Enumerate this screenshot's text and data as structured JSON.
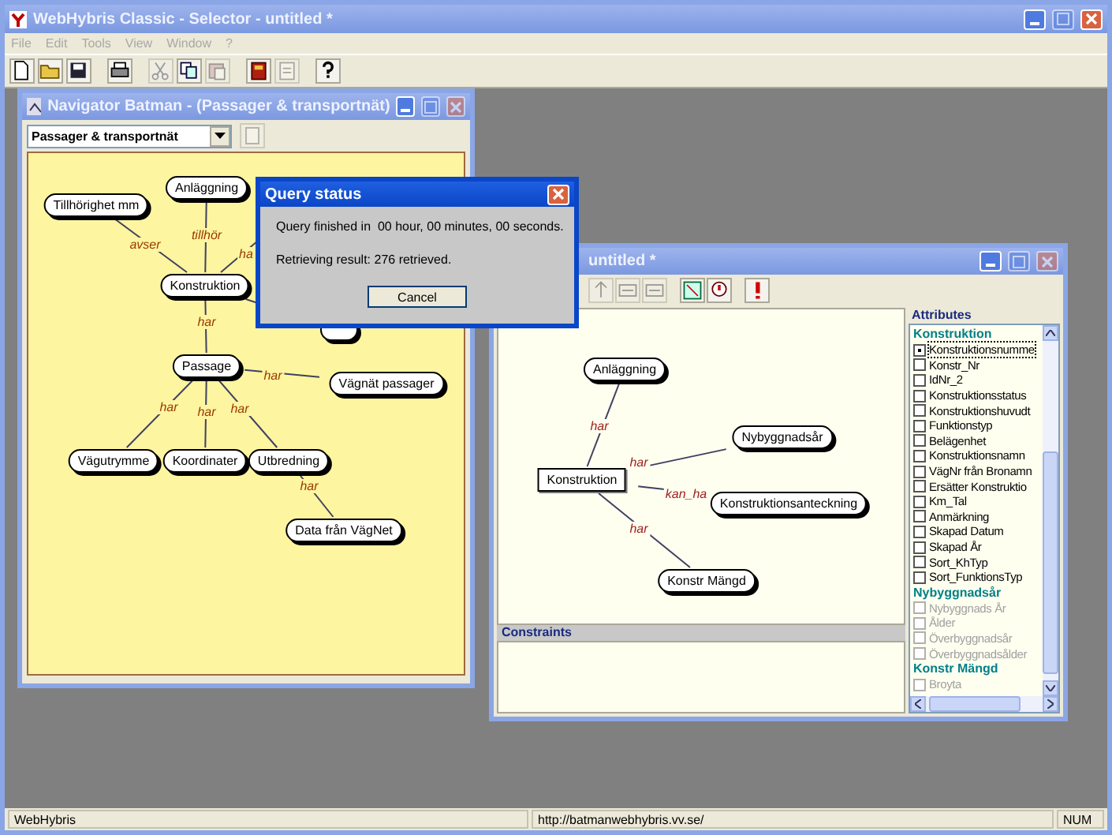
{
  "app": {
    "title": "WebHybris Classic - Selector - untitled *",
    "active": false,
    "menu": [
      {
        "label": "File",
        "disabled": true
      },
      {
        "label": "Edit",
        "disabled": true
      },
      {
        "label": "Tools",
        "disabled": true
      },
      {
        "label": "View",
        "disabled": true
      },
      {
        "label": "Window",
        "disabled": true
      },
      {
        "label": "?",
        "disabled": true
      }
    ],
    "toolbar": [
      {
        "kind": "new",
        "disabled": false
      },
      {
        "kind": "open",
        "disabled": false
      },
      {
        "kind": "save",
        "disabled": false
      },
      {
        "kind": "print",
        "disabled": false
      },
      {
        "kind": "cut",
        "disabled": true
      },
      {
        "kind": "copy",
        "disabled": false
      },
      {
        "kind": "paste",
        "disabled": true
      },
      {
        "kind": "book",
        "disabled": false
      },
      {
        "kind": "page",
        "disabled": true
      },
      {
        "kind": "help",
        "disabled": false
      }
    ]
  },
  "navigator": {
    "title": "Navigator Batman - (Passager & transportnät)",
    "active": false,
    "combo": {
      "value": "Passager & transportnät"
    },
    "nodes": [
      {
        "label": "Anläggning"
      },
      {
        "label": "Tillhörighet mm"
      },
      {
        "label": "Konstruktion"
      },
      {
        "label": "Passage"
      },
      {
        "label": "Vägnät passager"
      },
      {
        "label": "Vägutrymme"
      },
      {
        "label": "Koordinater"
      },
      {
        "label": "Utbredning"
      },
      {
        "label": "Data från VägNet"
      }
    ],
    "edge_labels": [
      {
        "text": "tillhör"
      },
      {
        "text": "avser"
      },
      {
        "text": "ha"
      },
      {
        "text": "har"
      },
      {
        "text": "har"
      },
      {
        "text": "har"
      },
      {
        "text": "har"
      },
      {
        "text": "har"
      },
      {
        "text": "har"
      }
    ]
  },
  "selector": {
    "title": "untitled *",
    "active": false,
    "toolbar": [
      {
        "kind": "up",
        "disabled": true
      },
      {
        "kind": "not",
        "disabled": true
      },
      {
        "kind": "not",
        "disabled": true
      },
      {
        "kind": "zoom",
        "disabled": false
      },
      {
        "kind": "query",
        "disabled": false
      },
      {
        "kind": "alert",
        "disabled": false
      }
    ],
    "nodes": [
      {
        "label": "Anläggning",
        "kind": "pill"
      },
      {
        "label": "Nybyggnadsår",
        "kind": "pill"
      },
      {
        "label": "Konstruktion",
        "kind": "box"
      },
      {
        "label": "Konstruktionsanteckning",
        "kind": "pill"
      },
      {
        "label": "Konstr Mängd",
        "kind": "pill"
      }
    ],
    "edge_labels": [
      {
        "text": "har"
      },
      {
        "text": "har"
      },
      {
        "text": "kan_ha"
      },
      {
        "text": "har"
      }
    ],
    "attributes": {
      "title": "Attributes",
      "groups": [
        {
          "title": "Konstruktion",
          "items": [
            {
              "label": "Konstruktionsnumme",
              "checked": true,
              "disabled": false
            },
            {
              "label": "Konstr_Nr",
              "checked": false,
              "disabled": false
            },
            {
              "label": "IdNr_2",
              "checked": false,
              "disabled": false
            },
            {
              "label": "Konstruktionsstatus",
              "checked": false,
              "disabled": false
            },
            {
              "label": "Konstruktionshuvudt",
              "checked": false,
              "disabled": false
            },
            {
              "label": "Funktionstyp",
              "checked": false,
              "disabled": false
            },
            {
              "label": "Belägenhet",
              "checked": false,
              "disabled": false
            },
            {
              "label": "Konstruktionsnamn",
              "checked": false,
              "disabled": false
            },
            {
              "label": "VägNr från Bronamn",
              "checked": false,
              "disabled": false
            },
            {
              "label": "Ersätter Konstruktio",
              "checked": false,
              "disabled": false
            },
            {
              "label": "Km_Tal",
              "checked": false,
              "disabled": false
            },
            {
              "label": "Anmärkning",
              "checked": false,
              "disabled": false
            },
            {
              "label": "Skapad Datum",
              "checked": false,
              "disabled": false
            },
            {
              "label": "Skapad År",
              "checked": false,
              "disabled": false
            },
            {
              "label": "Sort_KhTyp",
              "checked": false,
              "disabled": false
            },
            {
              "label": "Sort_FunktionsTyp",
              "checked": false,
              "disabled": false
            }
          ]
        },
        {
          "title": "Nybyggnadsår",
          "items": [
            {
              "label": "Nybyggnads År",
              "checked": false,
              "disabled": true
            },
            {
              "label": "Ålder",
              "checked": false,
              "disabled": true
            },
            {
              "label": "Överbyggnadsår",
              "checked": false,
              "disabled": true
            },
            {
              "label": "Överbyggnadsålder",
              "checked": false,
              "disabled": true
            }
          ]
        },
        {
          "title": "Konstr Mängd",
          "items": [
            {
              "label": "Broyta",
              "checked": false,
              "disabled": true
            }
          ]
        }
      ]
    },
    "constraints": {
      "title": "Constraints"
    }
  },
  "dialog": {
    "title": "Query status",
    "active": true,
    "lines": [
      "Query finished in  00 hour, 00 minutes, 00 seconds.",
      "Retrieving result: 276 retrieved."
    ],
    "button": "Cancel"
  },
  "status_bar": {
    "left": "WebHybris",
    "url": "http://batmanwebhybris.vv.se/",
    "indicator": "NUM"
  }
}
